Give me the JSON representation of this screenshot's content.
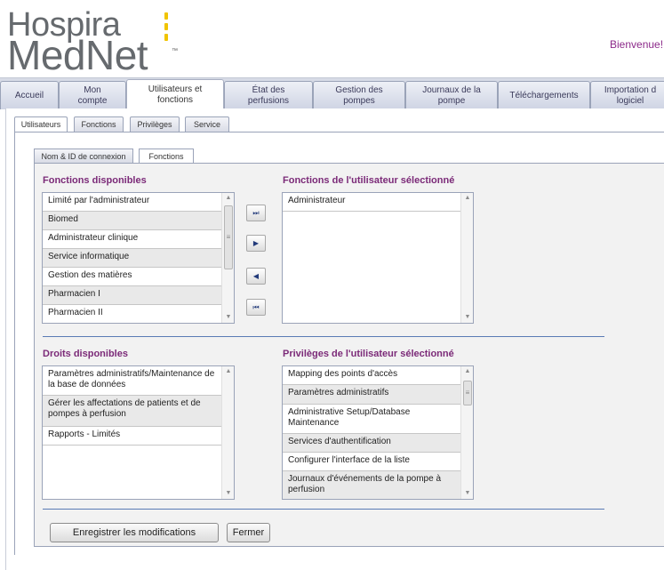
{
  "header": {
    "logo_line1": "Hospira",
    "logo_line2": "MedNet",
    "logo_tm": "™",
    "welcome": "Bienvenue!"
  },
  "main_tabs": [
    {
      "line1": "Accueil",
      "line2": ""
    },
    {
      "line1": "Mon",
      "line2": "compte"
    },
    {
      "line1": "Utilisateurs et",
      "line2": "fonctions"
    },
    {
      "line1": "État des",
      "line2": "perfusions"
    },
    {
      "line1": "Gestion des",
      "line2": "pompes"
    },
    {
      "line1": "Journaux de la",
      "line2": "pompe"
    },
    {
      "line1": "Téléchargements",
      "line2": ""
    },
    {
      "line1": "Importation d",
      "line2": "logiciel"
    }
  ],
  "sub_tabs": [
    "Utilisateurs",
    "Fonctions",
    "Privilèges",
    "Service"
  ],
  "inner_tabs": [
    "Nom & ID de connexion",
    "Fonctions"
  ],
  "fonctions_disponibles": {
    "title": "Fonctions disponibles",
    "items": [
      "Limité par l'administrateur",
      "Biomed",
      "Administrateur clinique",
      "Service informatique",
      "Gestion des matières",
      "Pharmacien I",
      "Pharmacien II"
    ]
  },
  "fonctions_utilisateur": {
    "title": "Fonctions de l'utilisateur sélectionné",
    "items": [
      "Administrateur"
    ]
  },
  "move_buttons": {
    "add_all": "⏭",
    "add": "▶",
    "remove": "◀",
    "remove_all": "⏮"
  },
  "droits_disponibles": {
    "title": "Droits disponibles",
    "items": [
      "Paramètres administratifs/Maintenance de la base de données",
      "Gérer les affectations de patients et de pompes à perfusion",
      "Rapports - Limités"
    ]
  },
  "privileges_utilisateur": {
    "title": "Privilèges de l'utilisateur sélectionné",
    "items": [
      "Mapping des points d'accès",
      "Paramètres administratifs",
      "Administrative Setup/Database Maintenance",
      "Services d'authentification",
      "Configurer l'interface de la liste",
      "Journaux d'événements de la pompe à perfusion"
    ]
  },
  "buttons": {
    "save": "Enregistrer les modifications",
    "close": "Fermer"
  },
  "colors": {
    "accent_purple": "#7b2a78",
    "logo_gray": "#666a6e",
    "logo_yellow": "#f0c400",
    "divider_blue": "#5a7bb5"
  }
}
